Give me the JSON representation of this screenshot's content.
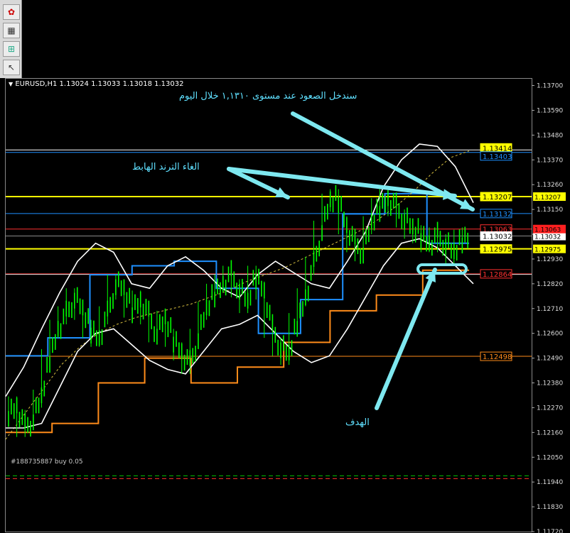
{
  "header": {
    "dropdown_icon": "triangle-down-icon",
    "symbol_info": "EURUSD,H1  1.13024 1.13033 1.13018 1.13032"
  },
  "toolbar": {
    "icons": [
      "logo-icon",
      "chart-icon",
      "indicator-icon",
      "cursor-icon"
    ]
  },
  "annotations": {
    "top_text": "سندخل الصعود عند مستوى ١,١٣١٠ خلال اليوم",
    "trend_text": "الغاء الترند الهابط",
    "target_text": "الهدف"
  },
  "trade_line_label": "#188735887 buy 0.05",
  "colors": {
    "background": "#000000",
    "candle": "#00ff00",
    "yellow_line": "#ffff00",
    "blue_line": "#1e90ff",
    "red_line": "#ff3030",
    "orange_line": "#ff8c1a",
    "annotation": "#7ee8f0",
    "band": "#ffffff"
  },
  "chart_data": {
    "type": "line",
    "symbol": "EURUSD",
    "timeframe": "H1",
    "ohlc_header": [
      1.13024,
      1.13033,
      1.13018,
      1.13032
    ],
    "ylim": [
      1.1172,
      1.1373
    ],
    "y_ticks": [
      "1.13700",
      "1.13590",
      "1.13480",
      "1.13370",
      "1.13260",
      "1.13150",
      "1.13040",
      "1.12930",
      "1.12820",
      "1.12710",
      "1.12600",
      "1.12490",
      "1.12380",
      "1.12270",
      "1.12160",
      "1.12050",
      "1.11940",
      "1.11830",
      "1.11720"
    ],
    "price_tags": [
      {
        "label": "1.13414",
        "value": 1.13414,
        "color": "#ffff00"
      },
      {
        "label": "1.13403",
        "value": 1.13403,
        "color": "#1e90ff"
      },
      {
        "label": "1.13207",
        "value": 1.13207,
        "color": "#ffff00"
      },
      {
        "label": "1.13132",
        "value": 1.13132,
        "color": "#1e90ff"
      },
      {
        "label": "1.13063",
        "value": 1.13063,
        "color": "#ff3030"
      },
      {
        "label": "1.13032",
        "value": 1.13032,
        "color": "#ffffff"
      },
      {
        "label": "1.12975",
        "value": 1.12975,
        "color": "#ffff00"
      },
      {
        "label": "1.12864",
        "value": 1.12864,
        "color": "#ff3030"
      },
      {
        "label": "1.12498",
        "value": 1.12498,
        "color": "#ff8c1a"
      }
    ],
    "trade_level": 1.11955,
    "price_path": [
      1.1225,
      1.1228,
      1.1218,
      1.1222,
      1.1231,
      1.1249,
      1.1262,
      1.1268,
      1.1276,
      1.127,
      1.1262,
      1.1258,
      1.1268,
      1.1282,
      1.1279,
      1.1271,
      1.1275,
      1.1268,
      1.126,
      1.1266,
      1.1258,
      1.1252,
      1.1246,
      1.1258,
      1.127,
      1.1278,
      1.1282,
      1.1286,
      1.128,
      1.1273,
      1.1286,
      1.1279,
      1.1262,
      1.1254,
      1.125,
      1.1265,
      1.1276,
      1.129,
      1.1306,
      1.1318,
      1.132,
      1.1308,
      1.13,
      1.1296,
      1.1308,
      1.1316,
      1.132,
      1.1316,
      1.1311,
      1.1306,
      1.1304,
      1.13,
      1.1303,
      1.13,
      1.1295,
      1.1302,
      1.1303
    ],
    "upper_band": [
      1.1232,
      1.1245,
      1.1262,
      1.1278,
      1.1292,
      1.13,
      1.1296,
      1.1282,
      1.128,
      1.129,
      1.1294,
      1.1288,
      1.128,
      1.1276,
      1.1286,
      1.1292,
      1.1287,
      1.1282,
      1.128,
      1.1292,
      1.1305,
      1.1325,
      1.1337,
      1.1344,
      1.1343,
      1.1334,
      1.1318
    ],
    "lower_band": [
      1.1218,
      1.1218,
      1.122,
      1.1236,
      1.1252,
      1.126,
      1.1262,
      1.1255,
      1.1248,
      1.1244,
      1.1242,
      1.1252,
      1.1262,
      1.1264,
      1.1268,
      1.126,
      1.1252,
      1.1247,
      1.125,
      1.1262,
      1.1276,
      1.129,
      1.13,
      1.1302,
      1.1298,
      1.129,
      1.1282
    ],
    "moving_average": [
      1.1213,
      1.1224,
      1.1235,
      1.1246,
      1.1254,
      1.126,
      1.1264,
      1.1267,
      1.1269,
      1.1271,
      1.1273,
      1.1276,
      1.1279,
      1.1283,
      1.1286,
      1.1289,
      1.1293,
      1.1297,
      1.1301,
      1.1305,
      1.131,
      1.1316,
      1.1323,
      1.1331,
      1.1338,
      1.1341
    ],
    "orange_steps": [
      1.1216,
      1.1216,
      1.122,
      1.122,
      1.1238,
      1.1238,
      1.1249,
      1.1249,
      1.1238,
      1.1238,
      1.1245,
      1.1245,
      1.1256,
      1.1256,
      1.127,
      1.127,
      1.1277,
      1.1277,
      1.1288,
      1.1288
    ],
    "blue_steps": [
      1.125,
      1.125,
      1.1258,
      1.1258,
      1.1286,
      1.1286,
      1.129,
      1.129,
      1.1292,
      1.1292,
      1.128,
      1.128,
      1.126,
      1.126,
      1.1275,
      1.1275,
      1.1313,
      1.1313,
      1.1322,
      1.1322,
      1.13,
      1.13
    ]
  }
}
